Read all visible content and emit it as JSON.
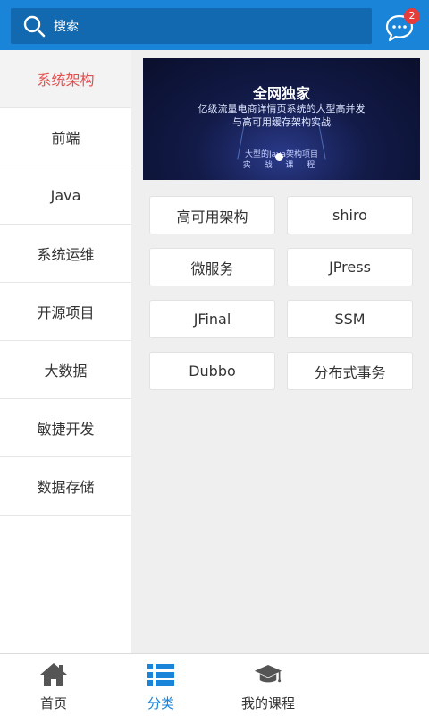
{
  "colors": {
    "accent": "#1a84d8",
    "active_text": "#e45050",
    "badge": "#e53b3b"
  },
  "header": {
    "search_placeholder": "搜索",
    "search_icon": "search-icon",
    "message_icon": "chat-bubble-icon",
    "message_badge": "2"
  },
  "sidebar": {
    "items": [
      {
        "label": "系统架构",
        "active": true
      },
      {
        "label": "前端"
      },
      {
        "label": "Java"
      },
      {
        "label": "系统运维"
      },
      {
        "label": "开源项目"
      },
      {
        "label": "大数据"
      },
      {
        "label": "敏捷开发"
      },
      {
        "label": "数据存储"
      }
    ]
  },
  "banner": {
    "title": "全网独家",
    "line1": "亿级流量电商详情页系统的大型高并发",
    "line2": "与高可用缓存架构实战",
    "tag1": "大型的Java架构项目",
    "tag2": "实 战 课 程"
  },
  "tags": [
    "高可用架构",
    "shiro",
    "微服务",
    "JPress",
    "JFinal",
    "SSM",
    "Dubbo",
    "分布式事务"
  ],
  "bottom_nav": {
    "items": [
      {
        "label": "首页",
        "icon": "home-icon"
      },
      {
        "label": "分类",
        "icon": "list-icon",
        "active": true
      },
      {
        "label": "我的课程",
        "icon": "graduation-cap-icon"
      }
    ]
  }
}
